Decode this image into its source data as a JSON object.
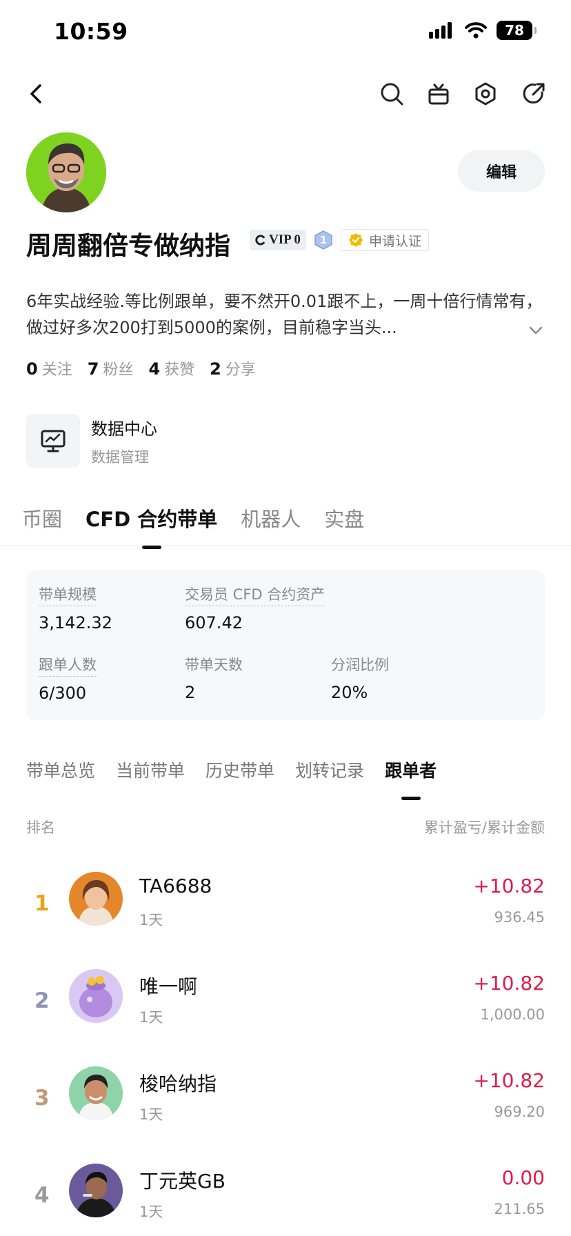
{
  "status_bar": {
    "time": "10:59",
    "battery": "78"
  },
  "profile": {
    "name": "周周翻倍专做纳指",
    "vip_label": "VIP 0",
    "level": "1",
    "cert_label": "申请认证",
    "edit_label": "编辑",
    "bio": "6年实战经验.等比例跟单，要不然开0.01跟不上，一周十倍行情常有，做过好多次200打到5000的案例，目前稳字当头...",
    "stats": [
      {
        "num": "0",
        "label": "关注"
      },
      {
        "num": "7",
        "label": "粉丝"
      },
      {
        "num": "4",
        "label": "获赞"
      },
      {
        "num": "2",
        "label": "分享"
      }
    ]
  },
  "data_center": {
    "title": "数据中心",
    "subtitle": "数据管理"
  },
  "main_tabs": [
    {
      "label": "币圈",
      "active": false
    },
    {
      "label": "CFD 合约带单",
      "active": true
    },
    {
      "label": "机器人",
      "active": false
    },
    {
      "label": "实盘",
      "active": false
    }
  ],
  "metrics": {
    "scale": {
      "label": "带单规模",
      "value": "3,142.32"
    },
    "assets": {
      "label": "交易员 CFD 合约资产",
      "value": "607.42"
    },
    "followers": {
      "label": "跟单人数",
      "value": "6/300"
    },
    "days": {
      "label": "带单天数",
      "value": "2"
    },
    "share": {
      "label": "分润比例",
      "value": "20%"
    }
  },
  "sub_tabs": [
    {
      "label": "带单总览",
      "active": false
    },
    {
      "label": "当前带单",
      "active": false
    },
    {
      "label": "历史带单",
      "active": false
    },
    {
      "label": "划转记录",
      "active": false
    },
    {
      "label": "跟单者",
      "active": true
    }
  ],
  "list_header": {
    "left": "排名",
    "right": "累计盈亏/累计金额"
  },
  "followers": [
    {
      "rank": "1",
      "name": "TA6688",
      "days": "1天",
      "pnl": "+10.82",
      "amount": "936.45"
    },
    {
      "rank": "2",
      "name": "唯一啊",
      "days": "1天",
      "pnl": "+10.82",
      "amount": "1,000.00"
    },
    {
      "rank": "3",
      "name": "梭哈纳指",
      "days": "1天",
      "pnl": "+10.82",
      "amount": "969.20"
    },
    {
      "rank": "4",
      "name": "丁元英GB",
      "days": "1天",
      "pnl": "0.00",
      "amount": "211.65"
    }
  ],
  "colors": {
    "profit": "#e6194b",
    "rank1": "#e8a317",
    "avatar_bg": "#7ed321"
  }
}
